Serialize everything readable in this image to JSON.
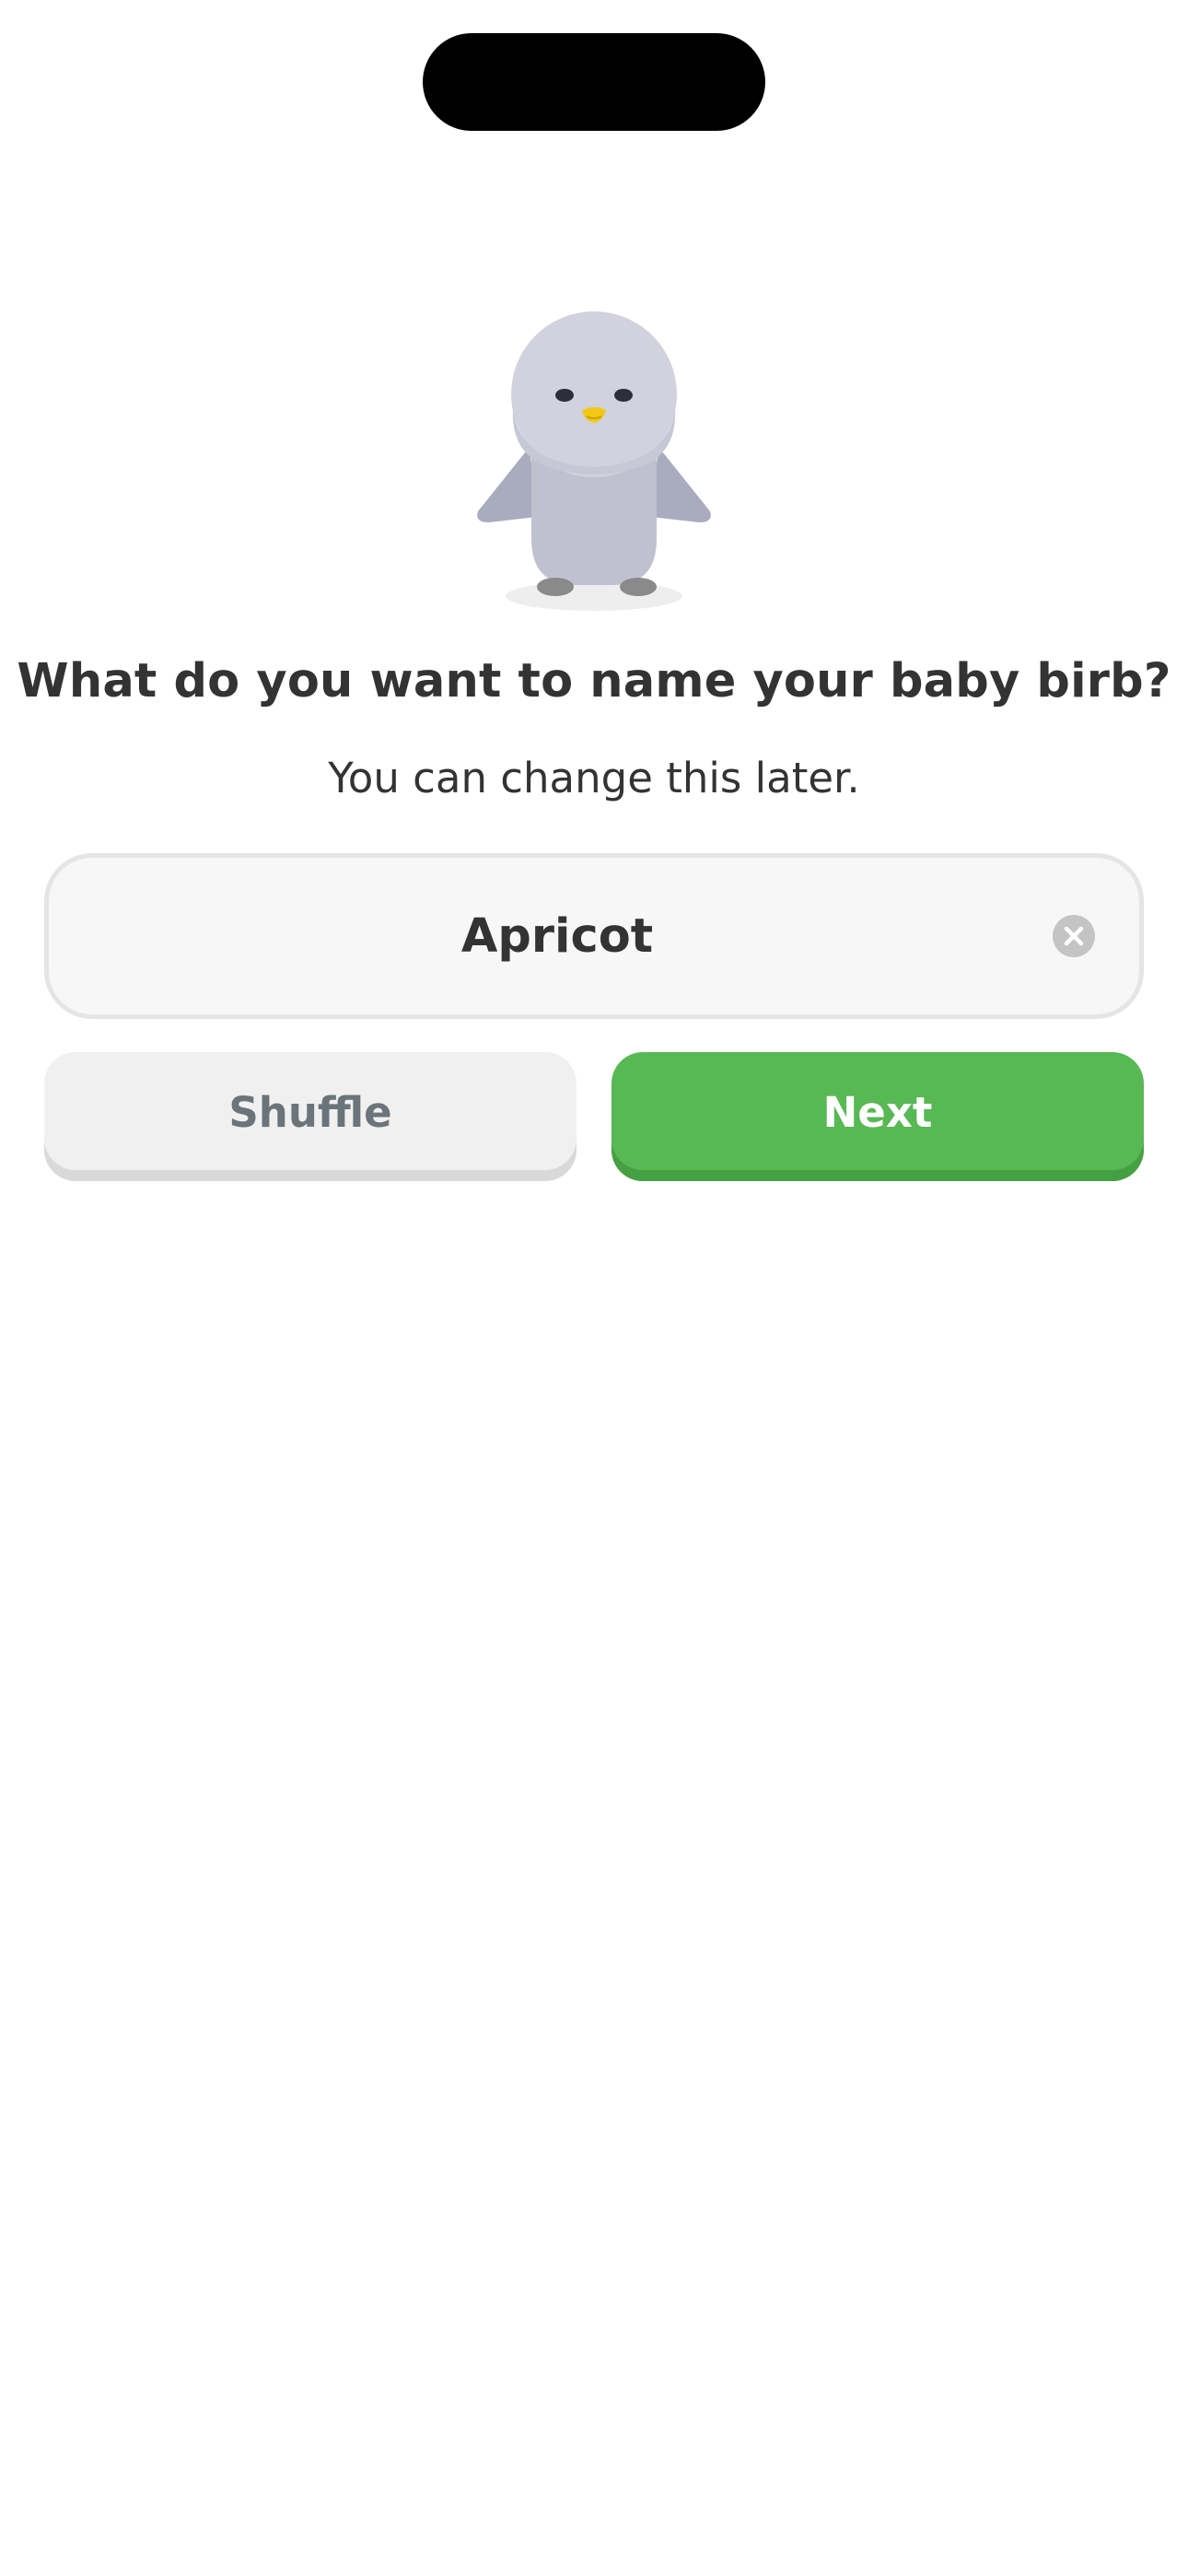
{
  "onboarding": {
    "title": "What do you want to name your baby birb?",
    "subtitle": "You can change this later.",
    "mascot_icon": "baby-bird-illustration"
  },
  "name_field": {
    "value": "Apricot",
    "placeholder": "",
    "clear_icon": "clear-circle-x-icon"
  },
  "actions": {
    "shuffle_label": "Shuffle",
    "next_label": "Next"
  },
  "colors": {
    "primary_green": "#58b854",
    "text_dark": "#333333",
    "field_bg": "#f7f7f7",
    "secondary_button_bg": "#f0f0f0"
  }
}
